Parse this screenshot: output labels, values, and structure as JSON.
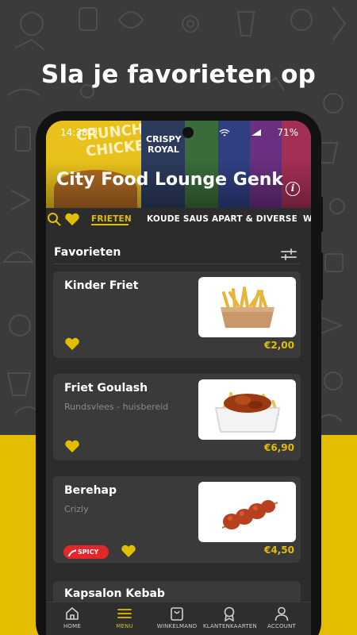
{
  "headline": "Sla je favorieten op",
  "status": {
    "time": "14:38",
    "battery": "71%"
  },
  "hero": {
    "brand_line1": "CRUNCHY",
    "brand_line2": "CHICKEN",
    "brand2_line1": "CRISPY",
    "brand2_line2": "ROYAL"
  },
  "restaurant_name": "City Food Lounge Genk",
  "tabs": [
    {
      "label": "FRIETEN",
      "active": true
    },
    {
      "label": "KOUDE SAUS APART & DIVERSE",
      "active": false
    },
    {
      "label": "W",
      "active": false
    }
  ],
  "section_title": "Favorieten",
  "items": [
    {
      "name": "Kinder Friet",
      "description": "",
      "price": "€2,00",
      "favorite": true,
      "spicy": false
    },
    {
      "name": "Friet Goulash",
      "description": "Rundsvlees - huisbereid",
      "price": "€6,90",
      "favorite": true,
      "spicy": false
    },
    {
      "name": "Berehap",
      "description": "Crizly",
      "price": "€4,50",
      "favorite": true,
      "spicy": true,
      "badge": "SPICY"
    },
    {
      "name": "Kapsalon Kebab",
      "description": "",
      "price": "",
      "favorite": true,
      "spicy": false
    }
  ],
  "nav": [
    {
      "label": "HOME",
      "icon": "home-icon",
      "active": false
    },
    {
      "label": "MENU",
      "icon": "menu-icon",
      "active": true
    },
    {
      "label": "WINKELMAND",
      "icon": "shopping-bag-icon",
      "active": false
    },
    {
      "label": "KLANTENKAARTEN",
      "icon": "award-icon",
      "active": false
    },
    {
      "label": "ACCOUNT",
      "icon": "user-icon",
      "active": false
    }
  ],
  "colors": {
    "accent": "#e2bd00",
    "background": "#2c2c2c",
    "card": "#3a3a3a",
    "spicy": "#e3262a"
  }
}
